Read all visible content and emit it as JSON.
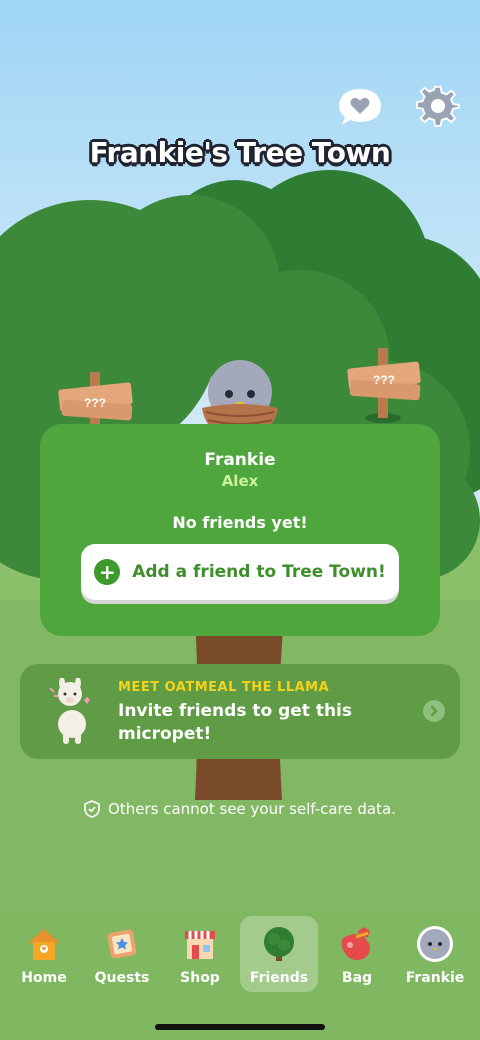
{
  "header": {
    "title": "Frankie's Tree Town",
    "icons": [
      "heart-speech-icon",
      "settings-gear-icon"
    ]
  },
  "signs": [
    "???",
    "???"
  ],
  "card": {
    "name": "Frankie",
    "subtitle": "Alex",
    "empty_text": "No friends yet!",
    "add_button_label": "Add a friend to Tree Town!"
  },
  "promo": {
    "kicker": "MEET OATMEAL THE LLAMA",
    "text": "Invite friends to get this micropet!"
  },
  "privacy_note": "Others cannot see your self-care data.",
  "tabs": [
    {
      "label": "Home",
      "icon": "house-icon"
    },
    {
      "label": "Quests",
      "icon": "quest-icon"
    },
    {
      "label": "Shop",
      "icon": "shop-icon"
    },
    {
      "label": "Friends",
      "icon": "tree-icon"
    },
    {
      "label": "Bag",
      "icon": "bag-icon"
    },
    {
      "label": "Frankie",
      "icon": "bird-avatar-icon"
    }
  ],
  "active_tab": "Friends",
  "colors": {
    "sky": "#9fd5f5",
    "grass": "#8cbf6a",
    "card_green": "#4ea63c",
    "accent_yellow": "#f5d21b",
    "button_text_green": "#3f8e2c"
  }
}
